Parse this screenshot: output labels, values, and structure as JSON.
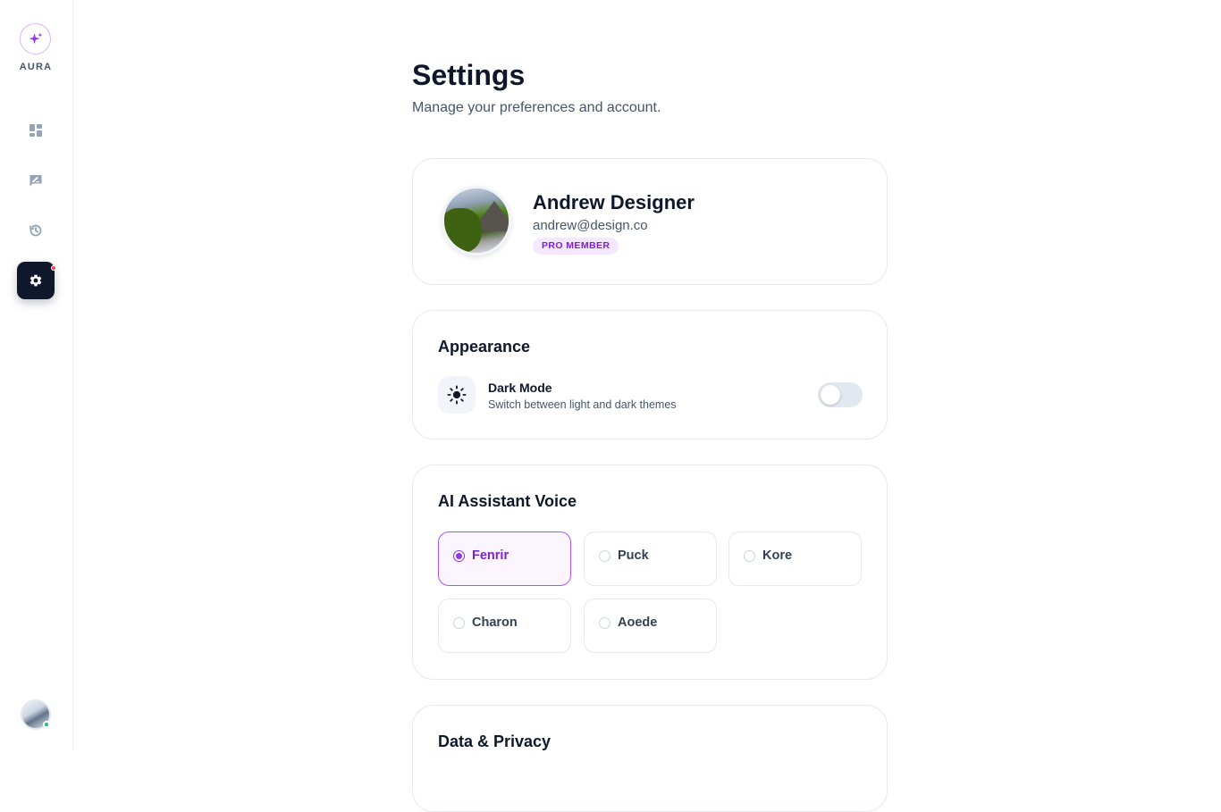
{
  "app": {
    "name": "AURA",
    "accent": "#9333ea"
  },
  "sidebar": {
    "items": [
      {
        "name": "dashboard",
        "icon": "dashboard-icon"
      },
      {
        "name": "feedback",
        "icon": "chat-edit-icon"
      },
      {
        "name": "history",
        "icon": "history-icon"
      },
      {
        "name": "settings",
        "icon": "gear-icon",
        "active": true,
        "notification": true
      }
    ]
  },
  "page": {
    "title": "Settings",
    "subtitle": "Manage your preferences and account."
  },
  "profile": {
    "name": "Andrew Designer",
    "email": "andrew@design.co",
    "badge": "PRO MEMBER"
  },
  "appearance": {
    "title": "Appearance",
    "dark_mode_label": "Dark Mode",
    "dark_mode_desc": "Switch between light and dark themes",
    "dark_mode_on": false
  },
  "voice": {
    "title": "AI Assistant Voice",
    "options": [
      "Fenrir",
      "Puck",
      "Kore",
      "Charon",
      "Aoede"
    ],
    "selected": "Fenrir"
  },
  "privacy": {
    "title": "Data & Privacy"
  }
}
